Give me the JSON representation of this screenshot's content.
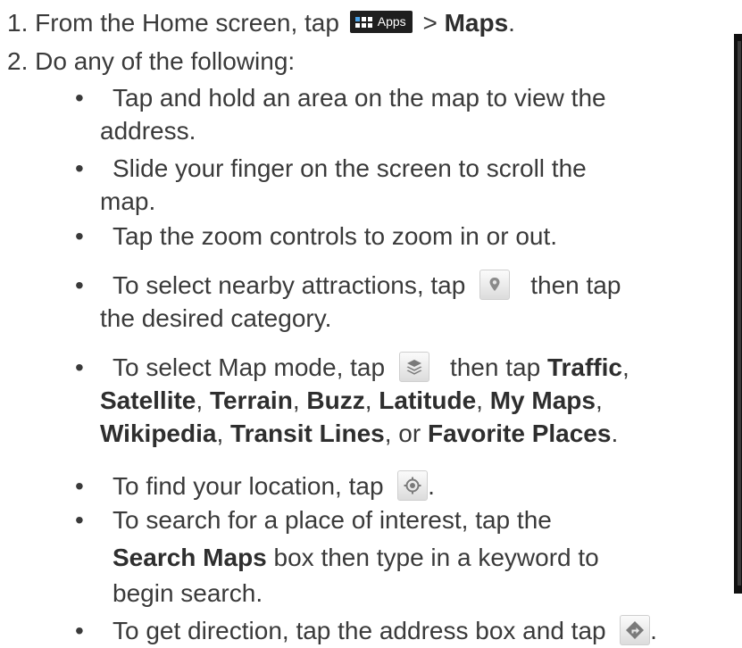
{
  "steps": [
    {
      "num": "1.",
      "before": "From the Home screen, tap",
      "button_label": "Apps",
      "gt": ">",
      "bold": "Maps",
      "after": "."
    },
    {
      "num": "2.",
      "text": "Do any of the following:"
    }
  ],
  "bullet_char": "•",
  "bullets": {
    "b1_l1": "Tap and hold an area on the map to view the",
    "b1_l2": "address.",
    "b2_l1": "Slide your finger on the screen to scroll the",
    "b2_l2": "map.",
    "b3": "Tap the zoom controls to zoom in or out.",
    "b4_a": "To select nearby attractions, tap",
    "b4_b": "then tap",
    "b4_l2": "the desired category.",
    "b5_a": "To select Map mode, tap",
    "b5_b": "then tap",
    "map_modes": [
      "Traffic",
      "Satellite",
      "Terrain",
      "Buzz",
      "Latitude",
      "My Maps",
      "Wikipedia",
      "Transit Lines",
      "Favorite Places"
    ],
    "sep": ",",
    "or_text": ", or",
    "end": ".",
    "b6_a": "To find your location, tap",
    "b6_end": ".",
    "b7_l1": "To search for a place of interest, tap the",
    "b7_bold": "Search Maps",
    "b7_l2_rest": "box then type in a keyword to",
    "b7_l3": "begin search.",
    "b8_a": "To get direction, tap the address box and tap",
    "b8_end": "."
  },
  "icons": {
    "apps": "apps-grid-icon",
    "places": "map-pin-icon",
    "layers": "layers-icon",
    "location": "my-location-icon",
    "directions": "directions-icon"
  }
}
